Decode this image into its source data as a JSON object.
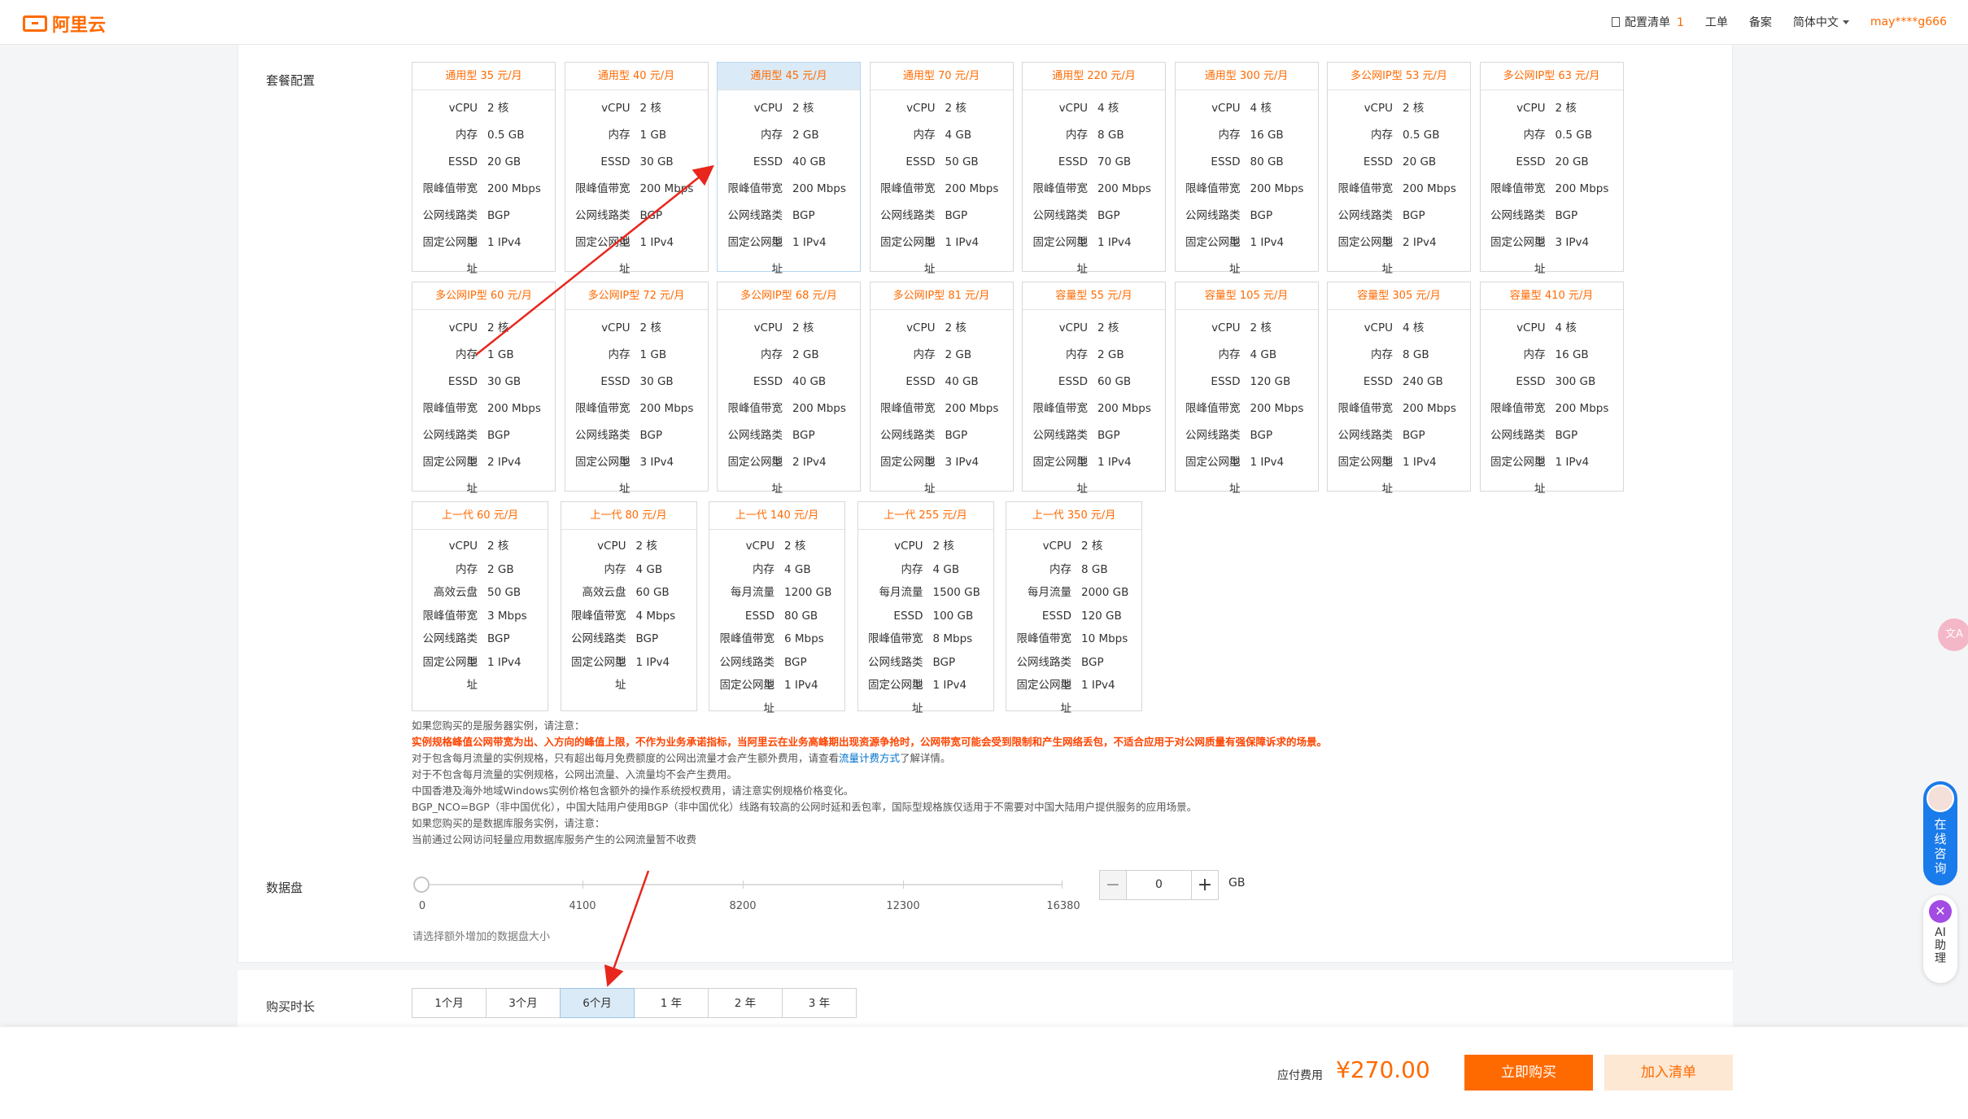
{
  "header": {
    "logo": "阿里云",
    "cart_label": "配置清单",
    "cart_count": "1",
    "ticket": "工单",
    "record": "备案",
    "language": "简体中文",
    "user": "may****g666"
  },
  "labels": {
    "package": "套餐配置",
    "data_disk": "数据盘",
    "duration": "购买时长"
  },
  "plans_row1": [
    {
      "title": "通用型 35 元/月",
      "specs": [
        [
          "vCPU",
          "2 核"
        ],
        [
          "内存",
          "0.5 GB"
        ],
        [
          "ESSD",
          "20 GB"
        ],
        [
          "限峰值带宽",
          "200 Mbps"
        ],
        [
          "公网线路类型",
          "BGP"
        ],
        [
          "固定公网地址",
          "1 IPv4"
        ]
      ]
    },
    {
      "title": "通用型 40 元/月",
      "specs": [
        [
          "vCPU",
          "2 核"
        ],
        [
          "内存",
          "1 GB"
        ],
        [
          "ESSD",
          "30 GB"
        ],
        [
          "限峰值带宽",
          "200 Mbps"
        ],
        [
          "公网线路类型",
          "BGP"
        ],
        [
          "固定公网地址",
          "1 IPv4"
        ]
      ]
    },
    {
      "title": "通用型 45 元/月",
      "specs": [
        [
          "vCPU",
          "2 核"
        ],
        [
          "内存",
          "2 GB"
        ],
        [
          "ESSD",
          "40 GB"
        ],
        [
          "限峰值带宽",
          "200 Mbps"
        ],
        [
          "公网线路类型",
          "BGP"
        ],
        [
          "固定公网地址",
          "1 IPv4"
        ]
      ]
    },
    {
      "title": "通用型 70 元/月",
      "specs": [
        [
          "vCPU",
          "2 核"
        ],
        [
          "内存",
          "4 GB"
        ],
        [
          "ESSD",
          "50 GB"
        ],
        [
          "限峰值带宽",
          "200 Mbps"
        ],
        [
          "公网线路类型",
          "BGP"
        ],
        [
          "固定公网地址",
          "1 IPv4"
        ]
      ]
    },
    {
      "title": "通用型 220 元/月",
      "specs": [
        [
          "vCPU",
          "4 核"
        ],
        [
          "内存",
          "8 GB"
        ],
        [
          "ESSD",
          "70 GB"
        ],
        [
          "限峰值带宽",
          "200 Mbps"
        ],
        [
          "公网线路类型",
          "BGP"
        ],
        [
          "固定公网地址",
          "1 IPv4"
        ]
      ]
    },
    {
      "title": "通用型 300 元/月",
      "specs": [
        [
          "vCPU",
          "4 核"
        ],
        [
          "内存",
          "16 GB"
        ],
        [
          "ESSD",
          "80 GB"
        ],
        [
          "限峰值带宽",
          "200 Mbps"
        ],
        [
          "公网线路类型",
          "BGP"
        ],
        [
          "固定公网地址",
          "1 IPv4"
        ]
      ]
    },
    {
      "title": "多公网IP型 53 元/月",
      "specs": [
        [
          "vCPU",
          "2 核"
        ],
        [
          "内存",
          "0.5 GB"
        ],
        [
          "ESSD",
          "20 GB"
        ],
        [
          "限峰值带宽",
          "200 Mbps"
        ],
        [
          "公网线路类型",
          "BGP"
        ],
        [
          "固定公网地址",
          "2 IPv4"
        ]
      ]
    },
    {
      "title": "多公网IP型 63 元/月",
      "specs": [
        [
          "vCPU",
          "2 核"
        ],
        [
          "内存",
          "0.5 GB"
        ],
        [
          "ESSD",
          "20 GB"
        ],
        [
          "限峰值带宽",
          "200 Mbps"
        ],
        [
          "公网线路类型",
          "BGP"
        ],
        [
          "固定公网地址",
          "3 IPv4"
        ]
      ]
    }
  ],
  "plans_row2": [
    {
      "title": "多公网IP型 60 元/月",
      "specs": [
        [
          "vCPU",
          "2 核"
        ],
        [
          "内存",
          "1 GB"
        ],
        [
          "ESSD",
          "30 GB"
        ],
        [
          "限峰值带宽",
          "200 Mbps"
        ],
        [
          "公网线路类型",
          "BGP"
        ],
        [
          "固定公网地址",
          "2 IPv4"
        ]
      ]
    },
    {
      "title": "多公网IP型 72 元/月",
      "specs": [
        [
          "vCPU",
          "2 核"
        ],
        [
          "内存",
          "1 GB"
        ],
        [
          "ESSD",
          "30 GB"
        ],
        [
          "限峰值带宽",
          "200 Mbps"
        ],
        [
          "公网线路类型",
          "BGP"
        ],
        [
          "固定公网地址",
          "3 IPv4"
        ]
      ]
    },
    {
      "title": "多公网IP型 68 元/月",
      "specs": [
        [
          "vCPU",
          "2 核"
        ],
        [
          "内存",
          "2 GB"
        ],
        [
          "ESSD",
          "40 GB"
        ],
        [
          "限峰值带宽",
          "200 Mbps"
        ],
        [
          "公网线路类型",
          "BGP"
        ],
        [
          "固定公网地址",
          "2 IPv4"
        ]
      ]
    },
    {
      "title": "多公网IP型 81 元/月",
      "specs": [
        [
          "vCPU",
          "2 核"
        ],
        [
          "内存",
          "2 GB"
        ],
        [
          "ESSD",
          "40 GB"
        ],
        [
          "限峰值带宽",
          "200 Mbps"
        ],
        [
          "公网线路类型",
          "BGP"
        ],
        [
          "固定公网地址",
          "3 IPv4"
        ]
      ]
    },
    {
      "title": "容量型 55 元/月",
      "specs": [
        [
          "vCPU",
          "2 核"
        ],
        [
          "内存",
          "2 GB"
        ],
        [
          "ESSD",
          "60 GB"
        ],
        [
          "限峰值带宽",
          "200 Mbps"
        ],
        [
          "公网线路类型",
          "BGP"
        ],
        [
          "固定公网地址",
          "1 IPv4"
        ]
      ]
    },
    {
      "title": "容量型 105 元/月",
      "specs": [
        [
          "vCPU",
          "2 核"
        ],
        [
          "内存",
          "4 GB"
        ],
        [
          "ESSD",
          "120 GB"
        ],
        [
          "限峰值带宽",
          "200 Mbps"
        ],
        [
          "公网线路类型",
          "BGP"
        ],
        [
          "固定公网地址",
          "1 IPv4"
        ]
      ]
    },
    {
      "title": "容量型 305 元/月",
      "specs": [
        [
          "vCPU",
          "4 核"
        ],
        [
          "内存",
          "8 GB"
        ],
        [
          "ESSD",
          "240 GB"
        ],
        [
          "限峰值带宽",
          "200 Mbps"
        ],
        [
          "公网线路类型",
          "BGP"
        ],
        [
          "固定公网地址",
          "1 IPv4"
        ]
      ]
    },
    {
      "title": "容量型 410 元/月",
      "specs": [
        [
          "vCPU",
          "4 核"
        ],
        [
          "内存",
          "16 GB"
        ],
        [
          "ESSD",
          "300 GB"
        ],
        [
          "限峰值带宽",
          "200 Mbps"
        ],
        [
          "公网线路类型",
          "BGP"
        ],
        [
          "固定公网地址",
          "1 IPv4"
        ]
      ]
    }
  ],
  "plans_row3": [
    {
      "title": "上一代 60 元/月",
      "specs": [
        [
          "vCPU",
          "2 核"
        ],
        [
          "内存",
          "2 GB"
        ],
        [
          "高效云盘",
          "50 GB"
        ],
        [
          "限峰值带宽",
          "3 Mbps"
        ],
        [
          "公网线路类型",
          "BGP"
        ],
        [
          "固定公网地址",
          "1 IPv4"
        ]
      ]
    },
    {
      "title": "上一代 80 元/月",
      "specs": [
        [
          "vCPU",
          "2 核"
        ],
        [
          "内存",
          "4 GB"
        ],
        [
          "高效云盘",
          "60 GB"
        ],
        [
          "限峰值带宽",
          "4 Mbps"
        ],
        [
          "公网线路类型",
          "BGP"
        ],
        [
          "固定公网地址",
          "1 IPv4"
        ]
      ]
    },
    {
      "title": "上一代 140 元/月",
      "specs": [
        [
          "vCPU",
          "2 核"
        ],
        [
          "内存",
          "4 GB"
        ],
        [
          "每月流量",
          "1200 GB"
        ],
        [
          "ESSD",
          "80 GB"
        ],
        [
          "限峰值带宽",
          "6 Mbps"
        ],
        [
          "公网线路类型",
          "BGP"
        ],
        [
          "固定公网地址",
          "1 IPv4"
        ]
      ]
    },
    {
      "title": "上一代 255 元/月",
      "specs": [
        [
          "vCPU",
          "2 核"
        ],
        [
          "内存",
          "4 GB"
        ],
        [
          "每月流量",
          "1500 GB"
        ],
        [
          "ESSD",
          "100 GB"
        ],
        [
          "限峰值带宽",
          "8 Mbps"
        ],
        [
          "公网线路类型",
          "BGP"
        ],
        [
          "固定公网地址",
          "1 IPv4"
        ]
      ]
    },
    {
      "title": "上一代 350 元/月",
      "specs": [
        [
          "vCPU",
          "2 核"
        ],
        [
          "内存",
          "8 GB"
        ],
        [
          "每月流量",
          "2000 GB"
        ],
        [
          "ESSD",
          "120 GB"
        ],
        [
          "限峰值带宽",
          "10 Mbps"
        ],
        [
          "公网线路类型",
          "BGP"
        ],
        [
          "固定公网地址",
          "1 IPv4"
        ]
      ]
    }
  ],
  "selected_plan": "通用型 45 元/月",
  "notes": {
    "line1": "如果您购买的是服务器实例，请注意：",
    "warn": "实例规格峰值公网带宽为出、入方向的峰值上限，不作为业务承诺指标，当阿里云在业务高峰期出现资源争抢时，公网带宽可能会受到限制和产生网络丢包，不适合应用于对公网质量有强保障诉求的场景。",
    "line3a": "对于包含每月流量的实例规格，只有超出每月免费额度的公网出流量才会产生额外费用，请查看",
    "line3link": "流量计费方式",
    "line3b": "了解详情。",
    "line4": "对于不包含每月流量的实例规格，公网出流量、入流量均不会产生费用。",
    "line5": "中国香港及海外地域Windows实例价格包含额外的操作系统授权费用，请注意实例规格价格变化。",
    "line6": "BGP_NCO=BGP（非中国优化），中国大陆用户使用BGP（非中国优化）线路有较高的公网时延和丢包率，国际型规格族仅适用于不需要对中国大陆用户提供服务的应用场景。",
    "line7": "如果您购买的是数据库服务实例，请注意：",
    "line8": "当前通过公网访问轻量应用数据库服务产生的公网流量暂不收费"
  },
  "disk": {
    "ticks": [
      "0",
      "4100",
      "8200",
      "12300",
      "16380"
    ],
    "value": "0",
    "unit": "GB",
    "hint": "请选择额外增加的数据盘大小",
    "minus": "−",
    "plus": "+"
  },
  "durations": [
    "1个月",
    "3个月",
    "6个月",
    "1 年",
    "2 年",
    "3 年"
  ],
  "selected_duration": "6个月",
  "footer": {
    "fee_label": "应付费用",
    "fee_amount": "¥270.00",
    "buy": "立即购买",
    "add": "加入清单"
  },
  "floating": {
    "translate": "文A",
    "consult": "在线咨询",
    "ai": "AI助理"
  },
  "colors": {
    "accent": "#ff6a00",
    "selected_bg": "#dbeaf7",
    "annotation_arrow": "#e8261c"
  }
}
